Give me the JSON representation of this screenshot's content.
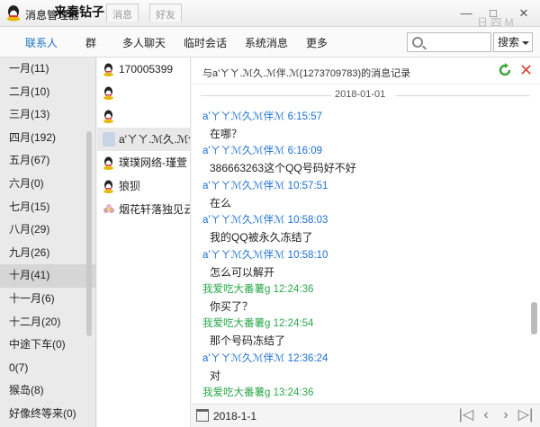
{
  "window": {
    "title": "消息管理器",
    "title_overlay": "来秦钻子",
    "ghost_tabs": [
      "消息",
      "好友"
    ],
    "ghost_letters": "日 四 M",
    "minimize": "—",
    "maximize": "□",
    "close": "✕"
  },
  "nav": {
    "items": [
      "联系人",
      "群",
      "多人聊天",
      "临时会话",
      "系统消息",
      "更多"
    ],
    "active_index": 0,
    "search_placeholder": "",
    "search_button": "搜索"
  },
  "months": [
    {
      "label": "一月(11)"
    },
    {
      "label": "二月(10)"
    },
    {
      "label": "三月(13)"
    },
    {
      "label": "四月(192)"
    },
    {
      "label": "五月(67)"
    },
    {
      "label": "六月(0)"
    },
    {
      "label": "七月(15)"
    },
    {
      "label": "八月(29)"
    },
    {
      "label": "九月(26)"
    },
    {
      "label": "十月(41)",
      "selected": true
    },
    {
      "label": "十一月(6)"
    },
    {
      "label": "十二月(20)"
    },
    {
      "label": "中途下车(0)"
    },
    {
      "label": "0(7)"
    },
    {
      "label": "猴岛(8)"
    },
    {
      "label": "好像终等来(0)"
    }
  ],
  "contacts": [
    {
      "name": "170005399",
      "icon": "penguin-icon"
    },
    {
      "name": "",
      "icon": "penguin-icon"
    },
    {
      "name": "",
      "icon": "penguin-icon"
    },
    {
      "name": "a'ㄚㄚ.ℳ久.ℳ伴ℳ",
      "icon": "avatar-icon",
      "selected": true
    },
    {
      "name": "璞璞网络-瑾萱",
      "icon": "penguin-icon"
    },
    {
      "name": "狼狈",
      "icon": "penguin-icon"
    },
    {
      "name": "烟花轩落独见云",
      "icon": "flower-icon"
    }
  ],
  "chat": {
    "header": "与a'ㄚㄚ.ℳ久.ℳ伴.ℳ(1273709783)的消息记录",
    "date_divider": "2018-01-01",
    "messages": [
      {
        "sender": "a'ㄚㄚℳ久ℳ伴ℳ 6:15:57",
        "color": "blue",
        "text": "在哪？"
      },
      {
        "sender": "a'ㄚㄚℳ久ℳ伴ℳ 6:16:09",
        "color": "blue",
        "text": "386663263这个QQ号码好不好"
      },
      {
        "sender": "a'ㄚㄚℳ久ℳ伴ℳ 10:57:51",
        "color": "blue",
        "text": "在么"
      },
      {
        "sender": "a'ㄚㄚℳ久ℳ伴ℳ 10:58:03",
        "color": "blue",
        "text": "我的QQ被永久冻结了"
      },
      {
        "sender": "a'ㄚㄚℳ久ℳ伴ℳ 10:58:10",
        "color": "blue",
        "text": "怎么可以解开"
      },
      {
        "sender": "我爱吃大番薯g 12:24:36",
        "color": "green",
        "text": "你买了？"
      },
      {
        "sender": "我爱吃大番薯g 12:24:54",
        "color": "green",
        "text": "那个号码冻结了"
      },
      {
        "sender": "a'ㄚㄚℳ久ℳ伴ℳ 12:36:24",
        "color": "blue",
        "text": "对"
      },
      {
        "sender": "我爱吃大番薯g 13:24:36",
        "color": "green",
        "text": ""
      }
    ]
  },
  "bottom": {
    "date": "2018-1-1",
    "first": "|◁",
    "prev": "‹",
    "next": "›",
    "last": "▷|"
  },
  "colors": {
    "accent": "#1a73c8",
    "sender_blue": "#1b6fd1",
    "sender_green": "#2aa84a",
    "close_red": "#e1433a",
    "refresh_green": "#3aa63a"
  }
}
